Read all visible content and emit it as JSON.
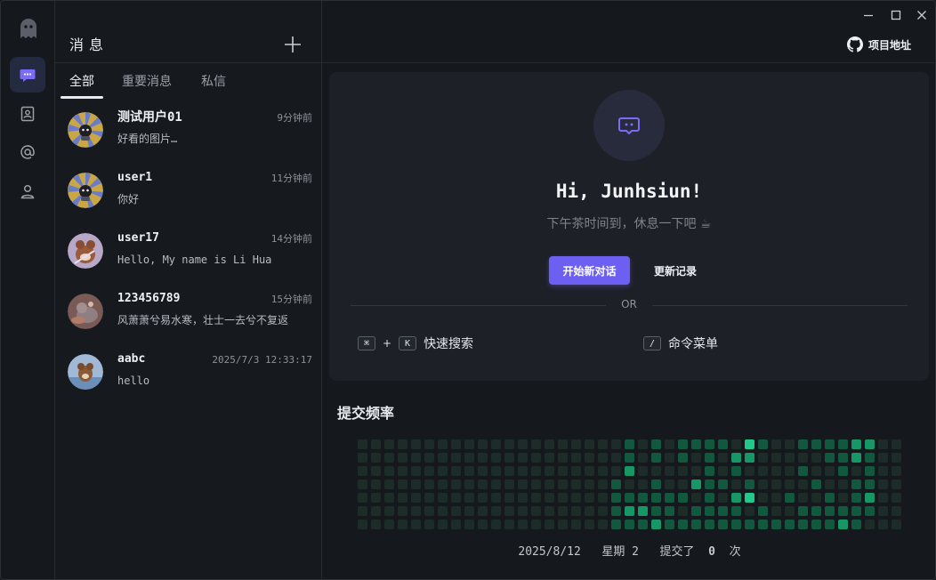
{
  "rail": {
    "items": [
      {
        "icon": "chat-icon",
        "active": true
      },
      {
        "icon": "contact-card-icon",
        "active": false
      },
      {
        "icon": "at-icon",
        "active": false
      },
      {
        "icon": "user-icon",
        "active": false
      }
    ]
  },
  "messages": {
    "title": "消息",
    "tabs": [
      "全部",
      "重要消息",
      "私信"
    ],
    "items": [
      {
        "name": "测试用户01",
        "time": "9分钟前",
        "preview": "好看的图片…"
      },
      {
        "name": "user1",
        "time": "11分钟前",
        "preview": "你好"
      },
      {
        "name": "user17",
        "time": "14分钟前",
        "preview": "Hello, My name is Li Hua"
      },
      {
        "name": "123456789",
        "time": "15分钟前",
        "preview": "风萧萧兮易水寒，壮士一去兮不复返"
      },
      {
        "name": "aabc",
        "time": "2025/7/3 12:33:17",
        "preview": "hello"
      }
    ]
  },
  "header": {
    "github_label": "项目地址"
  },
  "welcome": {
    "greeting": "Hi, Junhsiun!",
    "subtitle": "下午茶时间到，休息一下吧 ☕",
    "primary_button": "开始新对话",
    "secondary_button": "更新记录",
    "or_text": "OR",
    "shortcut1": {
      "keys": [
        "⌘",
        "K"
      ],
      "plus": "+",
      "label": "快速搜索"
    },
    "shortcut2": {
      "keys": [
        "/"
      ],
      "label": "命令菜单"
    }
  },
  "commits": {
    "title": "提交频率",
    "footer_date": "2025/8/12",
    "footer_weekday": "星期 2",
    "footer_text": "提交了",
    "footer_count": "0",
    "footer_unit": "次",
    "colors": [
      "#1d2c28",
      "#11583e",
      "#169765",
      "#23c98a"
    ],
    "levels": [
      "0000000000000000000000000000000000000000000000000000000000000000000000000000000000000000000000000000000000000000000000000000000000000000000000000000000000000000000000000000000000000000000000000000000000000000000000000000000000000000000000000000000000",
      "0000000000000000000000000000000000000000000000000000000000000000000000000000000000000000000000000000000000000000000000000000000000000000000000000000000000000000000000000000000000000000000000000000000000000000000000000000000000000000000000000000000000"
    ]
  }
}
